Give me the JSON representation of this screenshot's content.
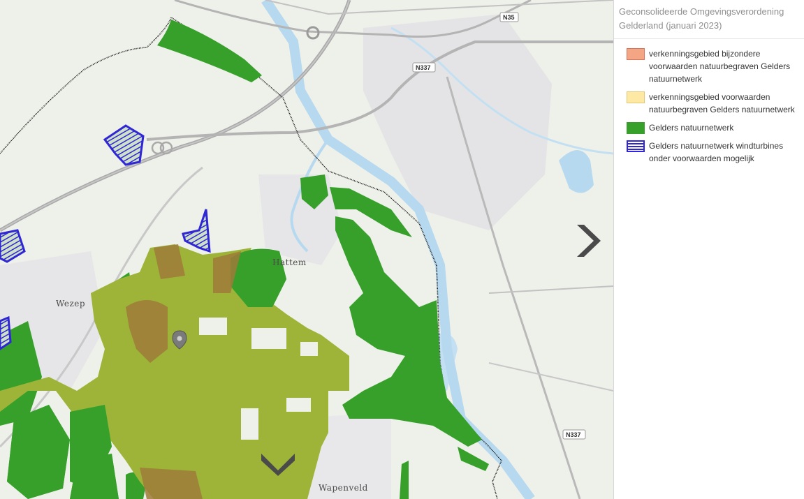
{
  "panel": {
    "title": "Geconsolideerde Omgevingsverordening Gelderland (januari 2023)"
  },
  "legend": {
    "items": [
      {
        "label": "verkenningsgebied bijzondere voorwaarden natuurbegraven Gelders natuurnetwerk",
        "icon": "salmon-fill-swatch",
        "fill": "#f4a583",
        "border": "#d9735a",
        "hatched": false
      },
      {
        "label": "verkenningsgebied voorwaarden natuurbegraven Gelders natuurnetwerk",
        "icon": "yellow-fill-swatch",
        "fill": "#fde8a4",
        "border": "#e3c774",
        "hatched": false
      },
      {
        "label": "Gelders natuurnetwerk",
        "icon": "green-fill-swatch",
        "fill": "#36a02a",
        "border": "#36a02a",
        "hatched": false
      },
      {
        "label": "Gelders natuurnetwerk windturbines onder voorwaarden mogelijk",
        "icon": "blue-hatched-swatch",
        "fill": "#ffffff",
        "border": "#2f26d6",
        "hatched": true
      }
    ]
  },
  "map": {
    "places": [
      {
        "id": "wezep",
        "label": "Wezep"
      },
      {
        "id": "hattem",
        "label": "Hattem"
      },
      {
        "id": "wapenveld",
        "label": "Wapenveld"
      }
    ],
    "roads": [
      {
        "id": "n35",
        "label": "N35"
      },
      {
        "id": "n337-north",
        "label": "N337"
      },
      {
        "id": "n337-south",
        "label": "N337"
      }
    ],
    "icons": [
      "location-pin-icon",
      "chevron-right-icon",
      "chevron-down-icon"
    ]
  },
  "colors": {
    "nnn_green": "#36a02a",
    "natuurbegraven_olive": "#9db439",
    "brown": "#9f7b3a",
    "windturbine_blue": "#2f26d6",
    "water": "#b7d9ef",
    "boundary": "#111111"
  }
}
